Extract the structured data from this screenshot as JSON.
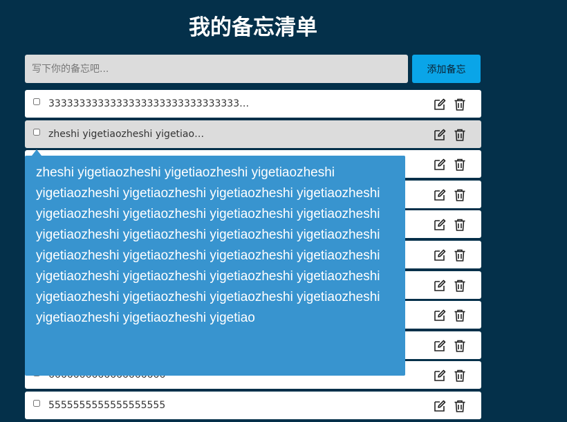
{
  "title": "我的备忘清单",
  "input": {
    "placeholder": "写下你的备忘吧...",
    "value": ""
  },
  "add_button": "添加备忘",
  "items": [
    {
      "text": "3333333333333333333333333333333…",
      "checked": false
    },
    {
      "text": "zheshi yigetiaozheshi yigetiao…",
      "checked": false,
      "hovered": true
    },
    {
      "text": "",
      "checked": false
    },
    {
      "text": "",
      "checked": false
    },
    {
      "text": "",
      "checked": false
    },
    {
      "text": "",
      "checked": false
    },
    {
      "text": "",
      "checked": false
    },
    {
      "text": "",
      "checked": false
    },
    {
      "text": "",
      "checked": false
    },
    {
      "text": "6666666666666666666",
      "checked": false
    },
    {
      "text": "5555555555555555555",
      "checked": false
    }
  ],
  "tooltip": {
    "text": "zheshi yigetiaozheshi yigetiaozheshi yigetiaozheshi yigetiaozheshi yigetiaozheshi yigetiaozheshi yigetiaozheshi yigetiaozheshi yigetiaozheshi yigetiaozheshi yigetiaozheshi yigetiaozheshi yigetiaozheshi yigetiaozheshi yigetiaozheshi yigetiaozheshi yigetiaozheshi yigetiaozheshi yigetiaozheshi yigetiaozheshi yigetiaozheshi yigetiaozheshi yigetiaozheshi yigetiaozheshi yigetiaozheshi yigetiaozheshi yigetiaozheshi yigetiaozheshi yigetiaozheshi yigetiao"
  },
  "icons": {
    "edit": "edit-icon",
    "delete": "trash-icon"
  },
  "colors": {
    "background": "#04304a",
    "accent": "#0aa5e8",
    "tooltip": "#3894cf"
  }
}
